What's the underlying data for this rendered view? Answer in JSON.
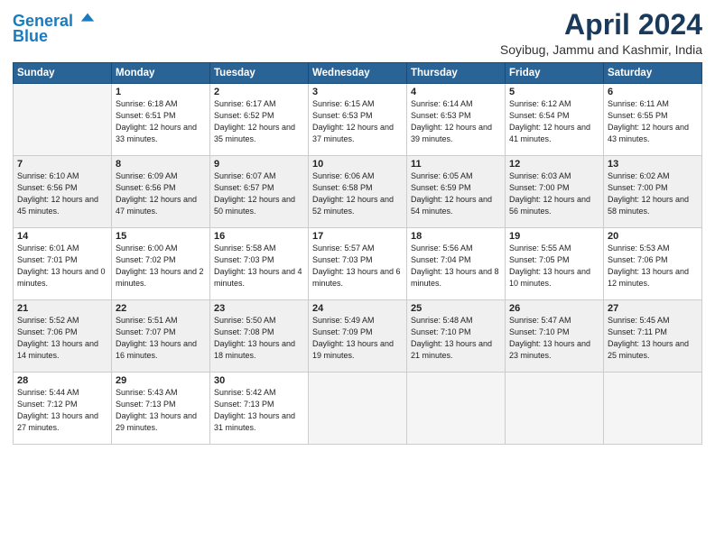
{
  "header": {
    "logo_line1": "General",
    "logo_line2": "Blue",
    "month": "April 2024",
    "location": "Soyibug, Jammu and Kashmir, India"
  },
  "weekdays": [
    "Sunday",
    "Monday",
    "Tuesday",
    "Wednesday",
    "Thursday",
    "Friday",
    "Saturday"
  ],
  "weeks": [
    [
      {
        "day": "",
        "sunrise": "",
        "sunset": "",
        "daylight": ""
      },
      {
        "day": "1",
        "sunrise": "Sunrise: 6:18 AM",
        "sunset": "Sunset: 6:51 PM",
        "daylight": "Daylight: 12 hours and 33 minutes."
      },
      {
        "day": "2",
        "sunrise": "Sunrise: 6:17 AM",
        "sunset": "Sunset: 6:52 PM",
        "daylight": "Daylight: 12 hours and 35 minutes."
      },
      {
        "day": "3",
        "sunrise": "Sunrise: 6:15 AM",
        "sunset": "Sunset: 6:53 PM",
        "daylight": "Daylight: 12 hours and 37 minutes."
      },
      {
        "day": "4",
        "sunrise": "Sunrise: 6:14 AM",
        "sunset": "Sunset: 6:53 PM",
        "daylight": "Daylight: 12 hours and 39 minutes."
      },
      {
        "day": "5",
        "sunrise": "Sunrise: 6:12 AM",
        "sunset": "Sunset: 6:54 PM",
        "daylight": "Daylight: 12 hours and 41 minutes."
      },
      {
        "day": "6",
        "sunrise": "Sunrise: 6:11 AM",
        "sunset": "Sunset: 6:55 PM",
        "daylight": "Daylight: 12 hours and 43 minutes."
      }
    ],
    [
      {
        "day": "7",
        "sunrise": "Sunrise: 6:10 AM",
        "sunset": "Sunset: 6:56 PM",
        "daylight": "Daylight: 12 hours and 45 minutes."
      },
      {
        "day": "8",
        "sunrise": "Sunrise: 6:09 AM",
        "sunset": "Sunset: 6:56 PM",
        "daylight": "Daylight: 12 hours and 47 minutes."
      },
      {
        "day": "9",
        "sunrise": "Sunrise: 6:07 AM",
        "sunset": "Sunset: 6:57 PM",
        "daylight": "Daylight: 12 hours and 50 minutes."
      },
      {
        "day": "10",
        "sunrise": "Sunrise: 6:06 AM",
        "sunset": "Sunset: 6:58 PM",
        "daylight": "Daylight: 12 hours and 52 minutes."
      },
      {
        "day": "11",
        "sunrise": "Sunrise: 6:05 AM",
        "sunset": "Sunset: 6:59 PM",
        "daylight": "Daylight: 12 hours and 54 minutes."
      },
      {
        "day": "12",
        "sunrise": "Sunrise: 6:03 AM",
        "sunset": "Sunset: 7:00 PM",
        "daylight": "Daylight: 12 hours and 56 minutes."
      },
      {
        "day": "13",
        "sunrise": "Sunrise: 6:02 AM",
        "sunset": "Sunset: 7:00 PM",
        "daylight": "Daylight: 12 hours and 58 minutes."
      }
    ],
    [
      {
        "day": "14",
        "sunrise": "Sunrise: 6:01 AM",
        "sunset": "Sunset: 7:01 PM",
        "daylight": "Daylight: 13 hours and 0 minutes."
      },
      {
        "day": "15",
        "sunrise": "Sunrise: 6:00 AM",
        "sunset": "Sunset: 7:02 PM",
        "daylight": "Daylight: 13 hours and 2 minutes."
      },
      {
        "day": "16",
        "sunrise": "Sunrise: 5:58 AM",
        "sunset": "Sunset: 7:03 PM",
        "daylight": "Daylight: 13 hours and 4 minutes."
      },
      {
        "day": "17",
        "sunrise": "Sunrise: 5:57 AM",
        "sunset": "Sunset: 7:03 PM",
        "daylight": "Daylight: 13 hours and 6 minutes."
      },
      {
        "day": "18",
        "sunrise": "Sunrise: 5:56 AM",
        "sunset": "Sunset: 7:04 PM",
        "daylight": "Daylight: 13 hours and 8 minutes."
      },
      {
        "day": "19",
        "sunrise": "Sunrise: 5:55 AM",
        "sunset": "Sunset: 7:05 PM",
        "daylight": "Daylight: 13 hours and 10 minutes."
      },
      {
        "day": "20",
        "sunrise": "Sunrise: 5:53 AM",
        "sunset": "Sunset: 7:06 PM",
        "daylight": "Daylight: 13 hours and 12 minutes."
      }
    ],
    [
      {
        "day": "21",
        "sunrise": "Sunrise: 5:52 AM",
        "sunset": "Sunset: 7:06 PM",
        "daylight": "Daylight: 13 hours and 14 minutes."
      },
      {
        "day": "22",
        "sunrise": "Sunrise: 5:51 AM",
        "sunset": "Sunset: 7:07 PM",
        "daylight": "Daylight: 13 hours and 16 minutes."
      },
      {
        "day": "23",
        "sunrise": "Sunrise: 5:50 AM",
        "sunset": "Sunset: 7:08 PM",
        "daylight": "Daylight: 13 hours and 18 minutes."
      },
      {
        "day": "24",
        "sunrise": "Sunrise: 5:49 AM",
        "sunset": "Sunset: 7:09 PM",
        "daylight": "Daylight: 13 hours and 19 minutes."
      },
      {
        "day": "25",
        "sunrise": "Sunrise: 5:48 AM",
        "sunset": "Sunset: 7:10 PM",
        "daylight": "Daylight: 13 hours and 21 minutes."
      },
      {
        "day": "26",
        "sunrise": "Sunrise: 5:47 AM",
        "sunset": "Sunset: 7:10 PM",
        "daylight": "Daylight: 13 hours and 23 minutes."
      },
      {
        "day": "27",
        "sunrise": "Sunrise: 5:45 AM",
        "sunset": "Sunset: 7:11 PM",
        "daylight": "Daylight: 13 hours and 25 minutes."
      }
    ],
    [
      {
        "day": "28",
        "sunrise": "Sunrise: 5:44 AM",
        "sunset": "Sunset: 7:12 PM",
        "daylight": "Daylight: 13 hours and 27 minutes."
      },
      {
        "day": "29",
        "sunrise": "Sunrise: 5:43 AM",
        "sunset": "Sunset: 7:13 PM",
        "daylight": "Daylight: 13 hours and 29 minutes."
      },
      {
        "day": "30",
        "sunrise": "Sunrise: 5:42 AM",
        "sunset": "Sunset: 7:13 PM",
        "daylight": "Daylight: 13 hours and 31 minutes."
      },
      {
        "day": "",
        "sunrise": "",
        "sunset": "",
        "daylight": ""
      },
      {
        "day": "",
        "sunrise": "",
        "sunset": "",
        "daylight": ""
      },
      {
        "day": "",
        "sunrise": "",
        "sunset": "",
        "daylight": ""
      },
      {
        "day": "",
        "sunrise": "",
        "sunset": "",
        "daylight": ""
      }
    ]
  ]
}
